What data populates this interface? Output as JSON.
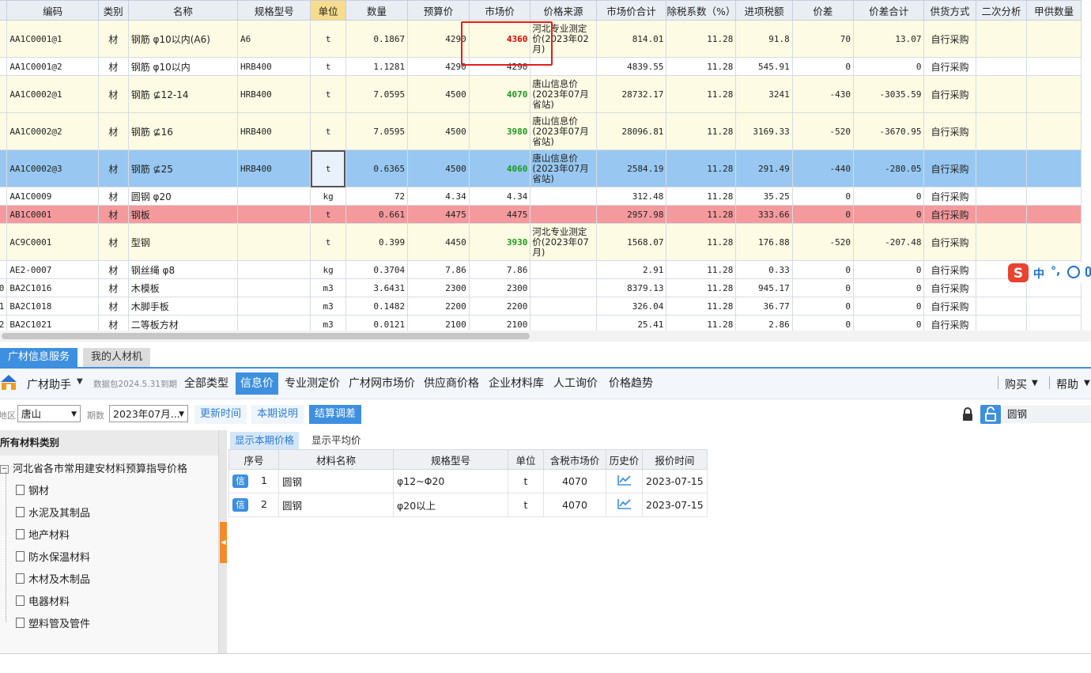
{
  "grid": {
    "headers": {
      "code": "编码",
      "type": "类别",
      "name": "名称",
      "spec": "规格型号",
      "unit": "单位",
      "qty": "数量",
      "budget": "预算价",
      "market": "市场价",
      "source": "价格来源",
      "total": "市场价合计",
      "tax_coef": "除税系数（%）",
      "input_tax": "进项税额",
      "diff": "价差",
      "diff_total": "价差合计",
      "supply": "供货方式",
      "second": "二次分析",
      "party_a_qty": "甲供数量"
    },
    "rows": [
      {
        "code": "AA1C0001@1",
        "type": "材",
        "name": "钢筋 φ10以内(A6)",
        "spec": "A6",
        "unit": "t",
        "qty": "0.1867",
        "budget": "4290",
        "market": "4360",
        "source": "河北专业测定价(2023年02月)",
        "total": "814.01",
        "tax_coef": "11.28",
        "input_tax": "91.8",
        "diff": "70",
        "diff_total": "13.07",
        "supply": "自行采购"
      },
      {
        "code": "AA1C0001@2",
        "type": "材",
        "name": "钢筋 φ10以内",
        "spec": "HRB400",
        "unit": "t",
        "qty": "1.1281",
        "budget": "4290",
        "market": "4290",
        "source": "",
        "total": "4839.55",
        "tax_coef": "11.28",
        "input_tax": "545.91",
        "diff": "0",
        "diff_total": "0",
        "supply": "自行采购"
      },
      {
        "code": "AA1C0002@1",
        "type": "材",
        "name": "钢筋 ⊈12-14",
        "spec": "HRB400",
        "unit": "t",
        "qty": "7.0595",
        "budget": "4500",
        "market": "4070",
        "source": "唐山信息价(2023年07月省站)",
        "total": "28732.17",
        "tax_coef": "11.28",
        "input_tax": "3241",
        "diff": "-430",
        "diff_total": "-3035.59",
        "supply": "自行采购"
      },
      {
        "code": "AA1C0002@2",
        "type": "材",
        "name": "钢筋 ⊈16",
        "spec": "HRB400",
        "unit": "t",
        "qty": "7.0595",
        "budget": "4500",
        "market": "3980",
        "source": "唐山信息价(2023年07月省站)",
        "total": "28096.81",
        "tax_coef": "11.28",
        "input_tax": "3169.33",
        "diff": "-520",
        "diff_total": "-3670.95",
        "supply": "自行采购"
      },
      {
        "code": "AA1C0002@3",
        "type": "材",
        "name": "钢筋 ⊈25",
        "spec": "HRB400",
        "unit": "t",
        "qty": "0.6365",
        "budget": "4500",
        "market": "4060",
        "source": "唐山信息价(2023年07月省站)",
        "total": "2584.19",
        "tax_coef": "11.28",
        "input_tax": "291.49",
        "diff": "-440",
        "diff_total": "-280.05",
        "supply": "自行采购"
      },
      {
        "code": "AA1C0009",
        "type": "材",
        "name": "圆钢 φ20",
        "spec": "",
        "unit": "kg",
        "qty": "72",
        "budget": "4.34",
        "market": "4.34",
        "source": "",
        "total": "312.48",
        "tax_coef": "11.28",
        "input_tax": "35.25",
        "diff": "0",
        "diff_total": "0",
        "supply": "自行采购"
      },
      {
        "code": "AB1C0001",
        "type": "材",
        "name": "钢板",
        "spec": "",
        "unit": "t",
        "qty": "0.661",
        "budget": "4475",
        "market": "4475",
        "source": "",
        "total": "2957.98",
        "tax_coef": "11.28",
        "input_tax": "333.66",
        "diff": "0",
        "diff_total": "0",
        "supply": "自行采购"
      },
      {
        "code": "AC9C0001",
        "type": "材",
        "name": "型钢",
        "spec": "",
        "unit": "t",
        "qty": "0.399",
        "budget": "4450",
        "market": "3930",
        "source": "河北专业测定价(2023年07月)",
        "total": "1568.07",
        "tax_coef": "11.28",
        "input_tax": "176.88",
        "diff": "-520",
        "diff_total": "-207.48",
        "supply": "自行采购"
      },
      {
        "code": "AE2-0007",
        "type": "材",
        "name": "钢丝绳 φ8",
        "spec": "",
        "unit": "kg",
        "qty": "0.3704",
        "budget": "7.86",
        "market": "7.86",
        "source": "",
        "total": "2.91",
        "tax_coef": "11.28",
        "input_tax": "0.33",
        "diff": "0",
        "diff_total": "0",
        "supply": "自行采购"
      },
      {
        "code": "BA2C1016",
        "type": "材",
        "name": "木模板",
        "spec": "",
        "unit": "m3",
        "qty": "3.6431",
        "budget": "2300",
        "market": "2300",
        "source": "",
        "total": "8379.13",
        "tax_coef": "11.28",
        "input_tax": "945.17",
        "diff": "0",
        "diff_total": "0",
        "supply": "自行采购"
      },
      {
        "code": "BA2C1018",
        "type": "材",
        "name": "木脚手板",
        "spec": "",
        "unit": "m3",
        "qty": "0.1482",
        "budget": "2200",
        "market": "2200",
        "source": "",
        "total": "326.04",
        "tax_coef": "11.28",
        "input_tax": "36.77",
        "diff": "0",
        "diff_total": "0",
        "supply": "自行采购"
      },
      {
        "code": "BA2C1021",
        "type": "材",
        "name": "二等板方材",
        "spec": "",
        "unit": "m3",
        "qty": "0.0121",
        "budget": "2100",
        "market": "2100",
        "source": "",
        "total": "25.41",
        "tax_coef": "11.28",
        "input_tax": "2.86",
        "diff": "0",
        "diff_total": "0",
        "supply": "自行采购"
      }
    ],
    "row_numbers": [
      "",
      "",
      "",
      "",
      "",
      "",
      "",
      "",
      "",
      "0",
      "1",
      "2"
    ]
  },
  "bottom_tabs": [
    "广材信息服务",
    "我的人材机"
  ],
  "toolbar": {
    "brand": "广材助手",
    "data_pack": "数据包2024.5.31到期",
    "tabs": [
      "全部类型",
      "信息价",
      "专业测定价",
      "广材网市场价",
      "供应商价格",
      "企业材料库",
      "人工询价",
      "价格趋势"
    ],
    "buy": "购买",
    "help": "帮助"
  },
  "filter": {
    "region_label": "地区",
    "region": "唐山",
    "period_label": "期数",
    "period": "2023年07月...",
    "btn_update": "更新时间",
    "btn_notes": "本期说明",
    "btn_settle": "结算调差",
    "search_value": "圆钢"
  },
  "tree": {
    "header": "所有材料类别",
    "root": "河北省各市常用建安材料预算指导价格",
    "items": [
      "钢材",
      "水泥及其制品",
      "地产材料",
      "防水保温材料",
      "木材及木制品",
      "电器材料",
      "塑料管及管件"
    ]
  },
  "results": {
    "tabs": [
      "显示本期价格",
      "显示平均价"
    ],
    "headers": [
      "序号",
      "材料名称",
      "规格型号",
      "单位",
      "含税市场价",
      "历史价",
      "报价时间"
    ],
    "badge": "信",
    "rows": [
      {
        "no": "1",
        "name": "圆钢",
        "spec": "φ12~Φ20",
        "unit": "t",
        "price": "4070",
        "date": "2023-07-15"
      },
      {
        "no": "2",
        "name": "圆钢",
        "spec": "φ20以上",
        "unit": "t",
        "price": "4070",
        "date": "2023-07-15"
      }
    ]
  },
  "ime": {
    "mode": "中",
    "punct": "°,"
  },
  "colors": {
    "accent": "#3d8fe0",
    "selected_row": "#98c8f1",
    "warn_row": "#f49a9d",
    "red_text": "#e00000",
    "green_text": "#1a9a1a",
    "splitter_handle": "#f28c28"
  }
}
